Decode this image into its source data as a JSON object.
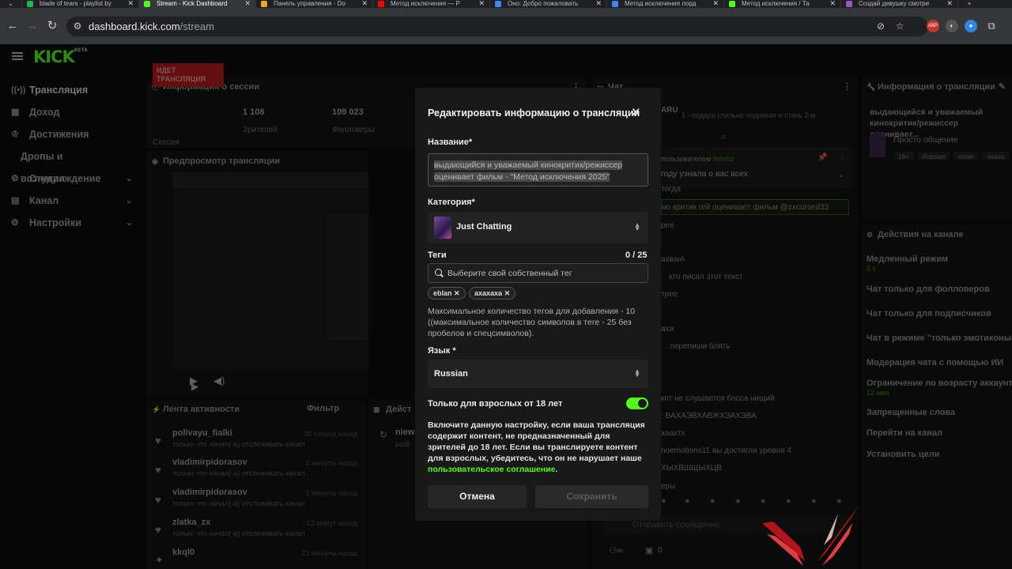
{
  "browser": {
    "tabs": [
      {
        "title": "blade of tears - playlist by",
        "color": "#1db954"
      },
      {
        "title": "Stream - Kick Dashboard",
        "color": "#53fc18",
        "active": true
      },
      {
        "title": "Панель управления - Do",
        "color": "#f5a623"
      },
      {
        "title": "Метод исключения — Р",
        "color": "#ff0000"
      },
      {
        "title": "Оно: Добро пожаловать",
        "color": "#4285f4"
      },
      {
        "title": "Метод исключения лорд",
        "color": "#4285f4"
      },
      {
        "title": "Метод исключения / Та",
        "color": "#53fc18"
      },
      {
        "title": "Создай девушку смотре",
        "color": "#9b59b6"
      }
    ],
    "url_host": "dashboard.kick.com",
    "url_path": "/stream"
  },
  "app": {
    "logo": "KICK",
    "logo_badge": "BETA",
    "sidebar": [
      {
        "label": "Трансляция",
        "icon": "broadcast-icon",
        "active": true
      },
      {
        "label": "Доход",
        "icon": "money-icon"
      },
      {
        "label": "Достижения",
        "icon": "trophy-icon"
      },
      {
        "label": "Дропы и вознаграждение",
        "sub": true
      },
      {
        "label": "Студия",
        "icon": "studio-icon",
        "chevron": true
      },
      {
        "label": "Канал",
        "icon": "channel-icon",
        "chevron": true
      },
      {
        "label": "Настройки",
        "icon": "gear-icon",
        "chevron": true
      }
    ],
    "session": {
      "header": "Информация о сессии",
      "live_badge": "ИДЕТ ТРАНСЛЯЦИЯ",
      "viewers_value": "1 108",
      "viewers_label": "Зрителей",
      "followers_value": "109 023",
      "followers_label": "Фолловеры",
      "session_label": "Сессия"
    },
    "preview_header": "Предпросмотр трансляции",
    "activity": {
      "header": "Лента активности",
      "filter": "Фильтр",
      "items": [
        {
          "name": "polivayu_fialki",
          "sub": "только что начал(-а) отслеживать канал",
          "time": "38 секунд назад"
        },
        {
          "name": "vladimirpidorasov",
          "sub": "только что начал(-а) отслеживать канал",
          "time": "2 минуты назад"
        },
        {
          "name": "vladimirpidorasov",
          "sub": "только что начал(-а) отслеживать канал",
          "time": "2 минуты назад"
        },
        {
          "name": "zlatka_zx",
          "sub": "только что начал(-а) отслеживать канал",
          "time": "12 минут назад"
        },
        {
          "name": "kkql0",
          "sub": "",
          "time": "23 минуты назад"
        }
      ]
    },
    "actions_partial": {
      "header": "Дейст",
      "item": "niew",
      "item_sub": "разб"
    },
    "chat": {
      "header": "Чат",
      "top_user": "ARU",
      "top_text": "1 - подари стильно подписки и стань 2-м",
      "pinned_by": "пользователем",
      "pinned_user": "fxmmz",
      "pinned_text": "году узнала о вас всех",
      "highlight": "но критик гей оценивает фильм @zxcursed33",
      "lines": [
        "тогда",
        "рее",
        "ахван\\",
        "кто писал этот текст",
        "трее",
        "аха",
        ": перепиши блять",
        "кпт не слушается босса нищий",
        ": ВАХАЭВХАВЖХЭАХЭВА",
        "хаахтх",
        "noemotions11 вы достигли уровня 4",
        "ХЫХВШЩЫХЦВ",
        "еры"
      ],
      "input_placeholder": "Отправить сообщение",
      "bottom_count": "0"
    },
    "stream_info": {
      "header": "Информация о трансляции",
      "title": "выдающийся и уважаемый кинокритик/режиссер оценивает...",
      "category": "Просто общение",
      "tags": [
        "18+",
        "Russian",
        "eblan",
        "ахаха"
      ]
    },
    "channel_actions": {
      "header": "Действия на канале",
      "items": [
        {
          "label": "Медленный режим",
          "sub": "5 с"
        },
        {
          "label": "Чат только для фолловеров"
        },
        {
          "label": "Чат только для подписчиков"
        },
        {
          "label": "Чат в режиме \"только эмотиконы\""
        },
        {
          "label": "Модерация чата с помощью ИИ"
        },
        {
          "label": "Ограничение по возрасту аккаунта",
          "sub": "12 мин"
        },
        {
          "label": "Запрещенные слова"
        },
        {
          "label": "Перейти на канал"
        },
        {
          "label": "Установить цели"
        }
      ]
    }
  },
  "modal": {
    "title": "Редактировать информацию о трансляции",
    "name_label": "Название*",
    "name_value": "выдающийся и уважаемый кинокритик/режиссер оценивает фильм - \"Метод исключения 2025\"",
    "category_label": "Категория*",
    "category_value": "Just Chatting",
    "tags_label": "Теги",
    "tags_count": "0 / 25",
    "tags_placeholder": "Выберите свой собственный тег",
    "tags": [
      "eblan",
      "ахахаха"
    ],
    "tags_help": "Максимальное количество тегов для добавления - 10 ((максимальное количество символов в теге - 25 без пробелов и спецсимволов).",
    "language_label": "Язык *",
    "language_value": "Russian",
    "adult_label": "Только для взрослых от 18 лет",
    "adult_enabled": true,
    "adult_desc": "Включите данную настройку, если ваша трансляция содержит контент, не предназначенный для зрителей до 18 лет. Если вы транслируете контент для взрослых, убедитесь, что он не нарушает наше",
    "adult_link": "пользовательское соглашение",
    "cancel": "Отмена",
    "save": "Сохранить"
  }
}
